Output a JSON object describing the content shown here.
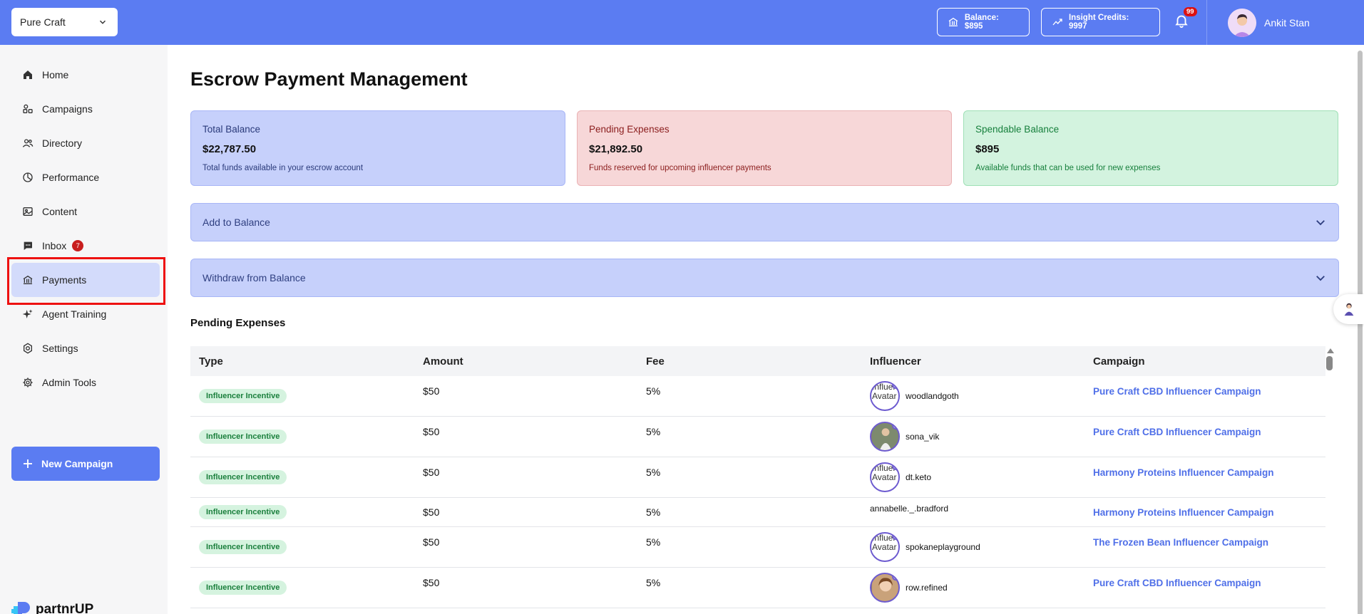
{
  "topbar": {
    "brand_select": "Pure Craft",
    "balance_label": "Balance: $895",
    "credits_label": "Insight Credits: 9997",
    "notification_count": "99",
    "user_name": "Ankit Stan"
  },
  "sidebar": {
    "items": [
      {
        "label": "Home",
        "icon": "home-icon"
      },
      {
        "label": "Campaigns",
        "icon": "campaigns-icon"
      },
      {
        "label": "Directory",
        "icon": "directory-icon"
      },
      {
        "label": "Performance",
        "icon": "performance-icon"
      },
      {
        "label": "Content",
        "icon": "image-icon"
      },
      {
        "label": "Inbox",
        "icon": "chat-icon",
        "badge": "7"
      },
      {
        "label": "Payments",
        "icon": "bank-icon",
        "active": true
      },
      {
        "label": "Agent Training",
        "icon": "sparkle-icon"
      },
      {
        "label": "Settings",
        "icon": "settings-icon"
      },
      {
        "label": "Admin Tools",
        "icon": "gear-icon"
      }
    ],
    "new_campaign": "New Campaign",
    "logo_text": "partnrUP"
  },
  "main": {
    "title": "Escrow Payment Management",
    "cards": {
      "total": {
        "title": "Total Balance",
        "value": "$22,787.50",
        "desc": "Total funds available in your escrow account"
      },
      "pending": {
        "title": "Pending Expenses",
        "value": "$21,892.50",
        "desc": "Funds reserved for upcoming influencer payments"
      },
      "spendable": {
        "title": "Spendable Balance",
        "value": "$895",
        "desc": "Available funds that can be used for new expenses"
      }
    },
    "accordion_add": "Add to Balance",
    "accordion_withdraw": "Withdraw from Balance",
    "section_title": "Pending Expenses",
    "table": {
      "headers": [
        "Type",
        "Amount",
        "Fee",
        "Influencer",
        "Campaign"
      ],
      "rows": [
        {
          "type": "Influencer Incentive",
          "amount": "$50",
          "fee": "5%",
          "influencer": "woodlandgoth",
          "avatar_alt": "Influencer Avatar",
          "campaign": "Pure Craft CBD Influencer Campaign"
        },
        {
          "type": "Influencer Incentive",
          "amount": "$50",
          "fee": "5%",
          "influencer": "sona_vik",
          "avatar_alt": "",
          "campaign": "Pure Craft CBD Influencer Campaign"
        },
        {
          "type": "Influencer Incentive",
          "amount": "$50",
          "fee": "5%",
          "influencer": "dt.keto",
          "avatar_alt": "Influencer Avatar",
          "campaign": "Harmony Proteins Influencer Campaign"
        },
        {
          "type": "Influencer Incentive",
          "amount": "$50",
          "fee": "5%",
          "influencer": "annabelle._.bradford",
          "avatar_alt": "",
          "campaign": "Harmony Proteins Influencer Campaign"
        },
        {
          "type": "Influencer Incentive",
          "amount": "$50",
          "fee": "5%",
          "influencer": "spokaneplayground",
          "avatar_alt": "Influencer Avatar",
          "campaign": "The Frozen Bean Influencer Campaign"
        },
        {
          "type": "Influencer Incentive",
          "amount": "$50",
          "fee": "5%",
          "influencer": "row.refined",
          "avatar_alt": "",
          "campaign": "Pure Craft CBD Influencer Campaign"
        }
      ]
    }
  },
  "colors": {
    "accent": "#5b7cf2",
    "link": "#4f6fe8",
    "badge_red": "#c81e1e"
  }
}
